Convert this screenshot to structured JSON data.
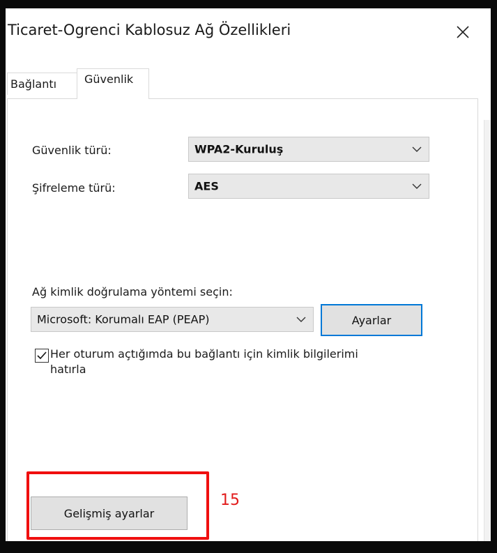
{
  "window": {
    "title": "Ticaret-Ogrenci Kablosuz Ağ Özellikleri"
  },
  "tabs": [
    {
      "label": "Bağlantı",
      "selected": false
    },
    {
      "label": "Güvenlik",
      "selected": true
    }
  ],
  "security": {
    "type_label": "Güvenlik türü:",
    "type_value": "WPA2-Kuruluş",
    "encryption_label": "Şifreleme türü:",
    "encryption_value": "AES"
  },
  "auth": {
    "method_label": "Ağ kimlik doğrulama yöntemi seçin:",
    "method_value": "Microsoft: Korumalı EAP (PEAP)",
    "settings_button": "Ayarlar"
  },
  "remember": {
    "checked": true,
    "label": "Her oturum açtığımda bu bağlantı için kimlik bilgilerimi hatırla"
  },
  "advanced_button": "Gelişmiş ayarlar",
  "annotation": {
    "step": "15",
    "color": "#f00f0f"
  },
  "icons": {
    "close": "close-icon",
    "dropdown": "chevron-down-icon",
    "check": "checkmark-icon"
  }
}
